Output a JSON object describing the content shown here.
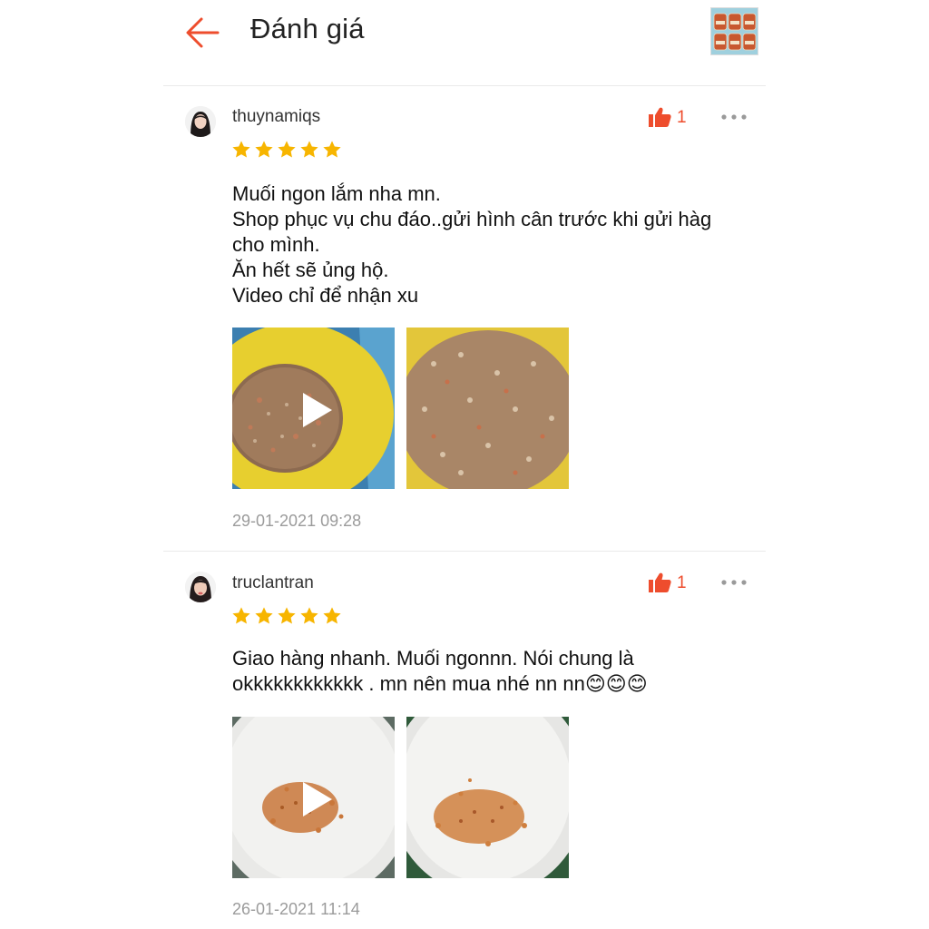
{
  "header": {
    "title": "Đánh giá",
    "back_icon": "arrow-left-icon",
    "accent_color": "#ee4d2d"
  },
  "reviews": [
    {
      "username": "thuynamiqs",
      "rating": 5,
      "likes": "1",
      "text_lines": [
        "Muối ngon lắm nha mn.",
        "Shop phục vụ chu đáo..gửi hình cân trước khi gửi hàg",
        "cho mình.",
        "Ăn hết sẽ ủng hộ.",
        "Video chỉ để nhận xu"
      ],
      "media": [
        {
          "type": "video",
          "icon": "play-icon"
        },
        {
          "type": "image"
        }
      ],
      "timestamp": "29-01-2021 09:28"
    },
    {
      "username": "truclantran",
      "rating": 5,
      "likes": "1",
      "text_lines": [
        "Giao hàng nhanh. Muối ngonnn. Nói chung là",
        "okkkkkkkkkkkk . mn nên mua nhé nn nn😊😊😊"
      ],
      "media": [
        {
          "type": "video",
          "icon": "play-icon"
        },
        {
          "type": "image"
        }
      ],
      "timestamp": "26-01-2021 11:14"
    }
  ],
  "colors": {
    "star": "#f7b500",
    "like": "#ee4d2d",
    "timestamp": "#9b9b9b",
    "divider": "#e9e9e9"
  }
}
